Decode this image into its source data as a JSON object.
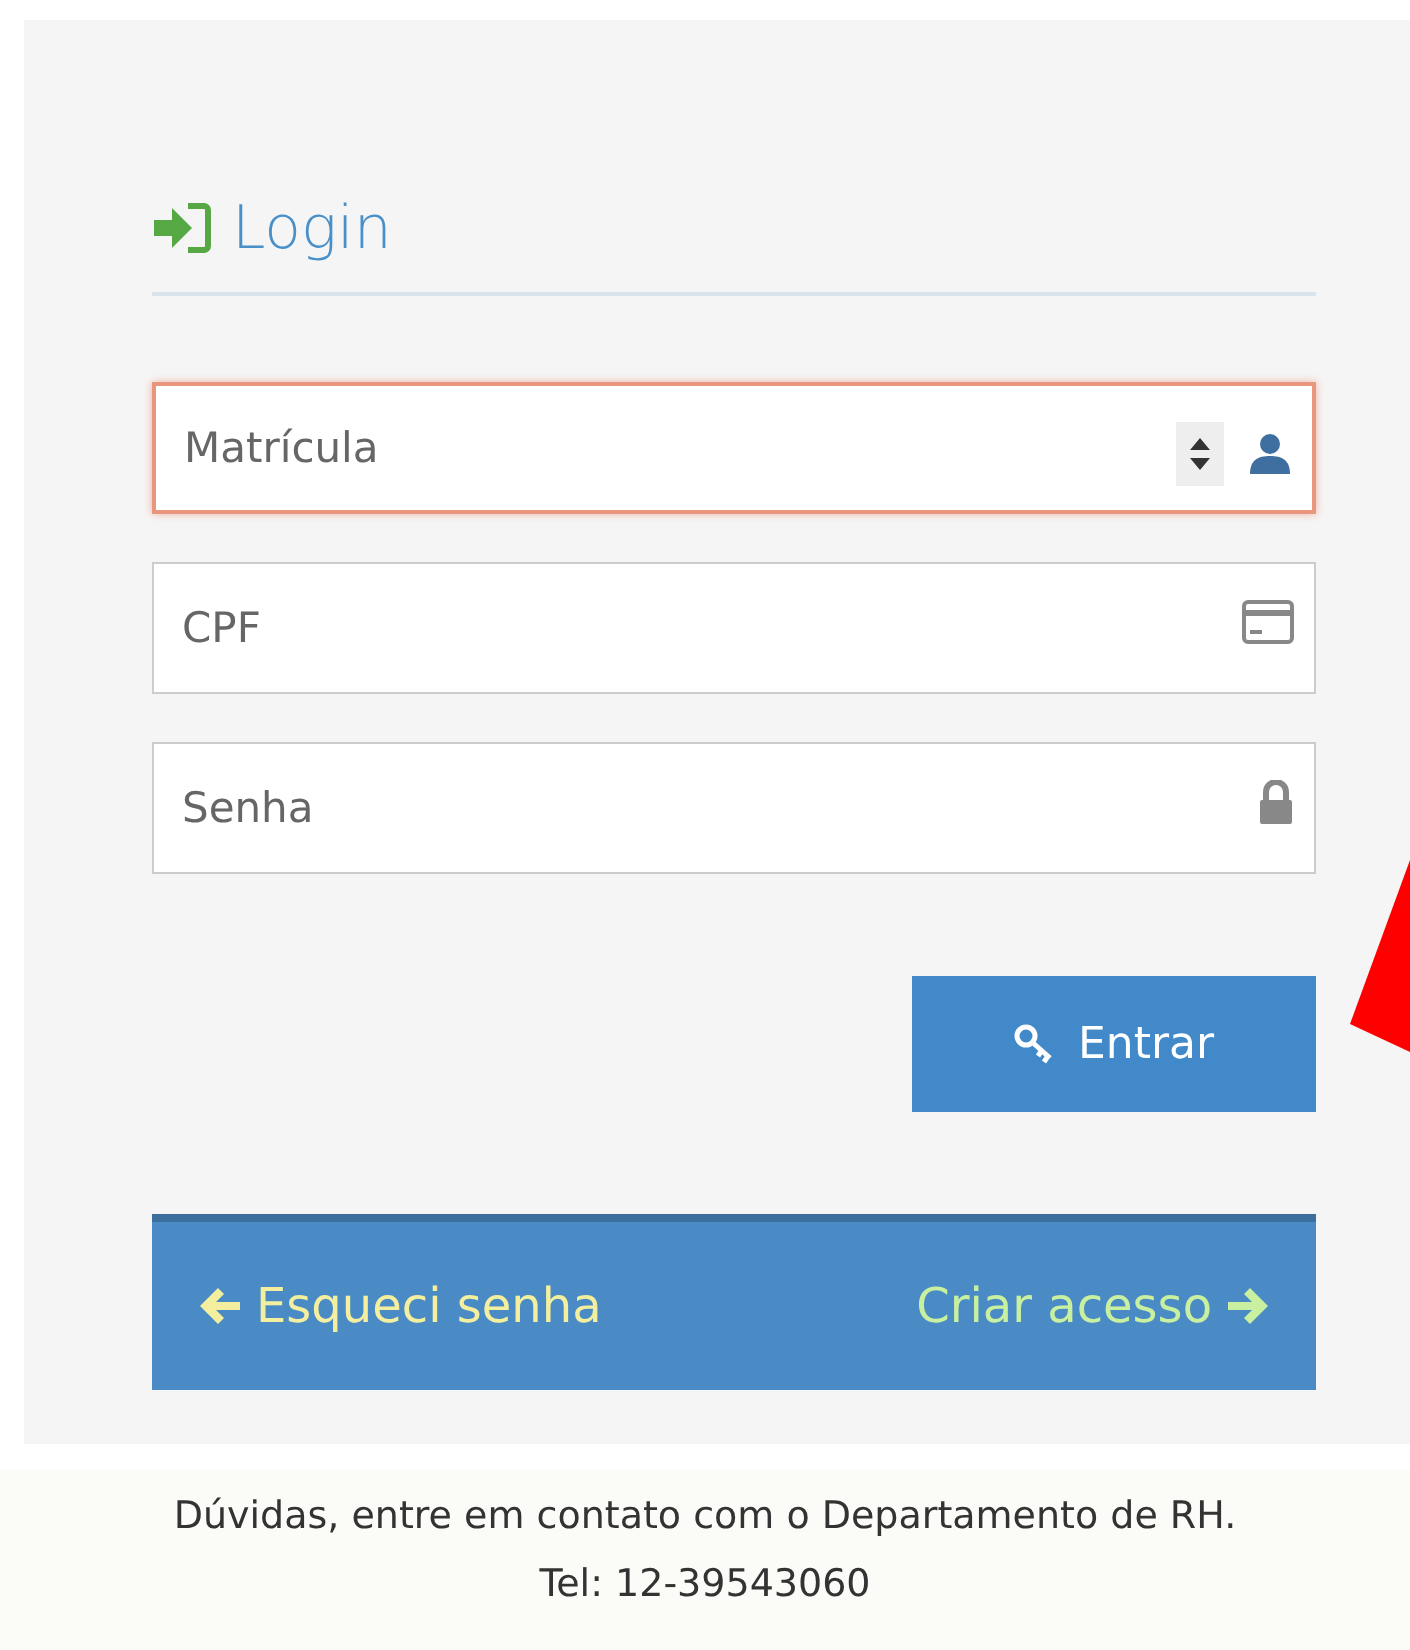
{
  "panel": {
    "title": "Login",
    "fields": [
      {
        "placeholder": "Matrícula",
        "kind": "number",
        "focused": true
      },
      {
        "placeholder": "CPF",
        "kind": "card",
        "focused": false
      },
      {
        "placeholder": "Senha",
        "kind": "password",
        "focused": false
      }
    ],
    "submit": {
      "label": "Entrar"
    },
    "links": [
      {
        "label": "Esqueci senha",
        "kind": "back"
      },
      {
        "label": "Criar acesso",
        "kind": "forward"
      }
    ]
  },
  "footer": {
    "lines": [
      "Dúvidas, entre em contato com o Departamento de RH.",
      "Tel: 12-39543060"
    ]
  }
}
